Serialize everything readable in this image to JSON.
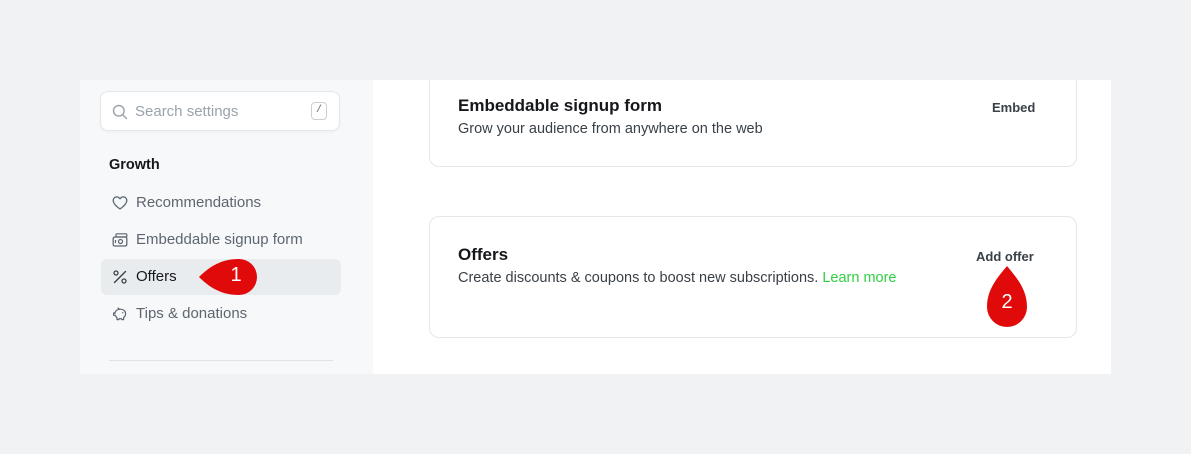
{
  "search": {
    "placeholder": "Search settings",
    "shortcut": "/"
  },
  "sidebar": {
    "group_title": "Growth",
    "items": [
      {
        "label": "Recommendations",
        "icon": "heart-icon"
      },
      {
        "label": "Embeddable signup form",
        "icon": "signup-form-icon"
      },
      {
        "label": "Offers",
        "icon": "percent-icon",
        "active": true
      },
      {
        "label": "Tips & donations",
        "icon": "piggy-bank-icon"
      }
    ]
  },
  "cards": {
    "signup": {
      "title": "Embeddable signup form",
      "description": "Grow your audience from anywhere on the web",
      "action": "Embed"
    },
    "offers": {
      "title": "Offers",
      "description": "Create discounts & coupons to boost new subscriptions.",
      "link": "Learn more",
      "action": "Add offer"
    }
  },
  "annotations": {
    "marker1": "1",
    "marker2": "2",
    "color": "#e00a0a"
  },
  "colors": {
    "accent_green": "#30cf43",
    "active_bg": "#e9ecef"
  }
}
